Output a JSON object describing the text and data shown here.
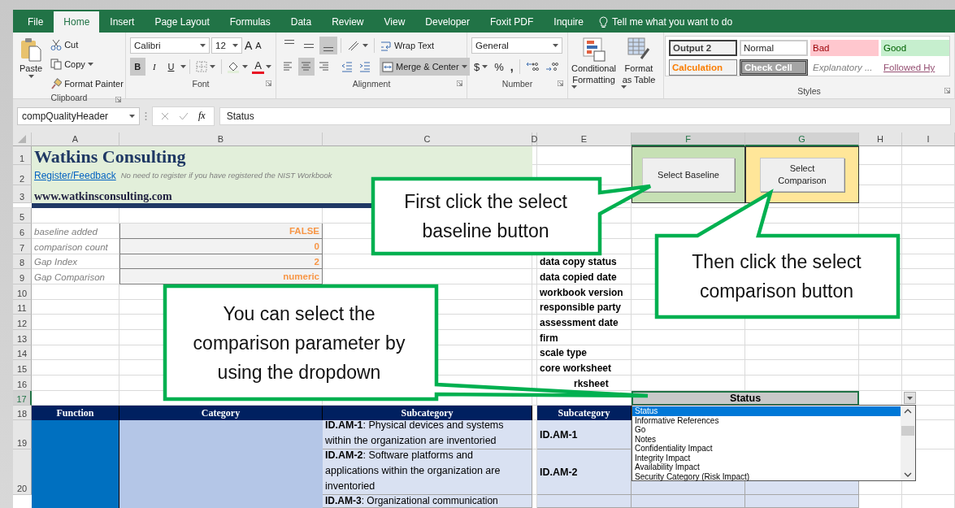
{
  "ribbon_tabs": [
    {
      "label": "File",
      "selected": false
    },
    {
      "label": "Home",
      "selected": true
    },
    {
      "label": "Insert",
      "selected": false
    },
    {
      "label": "Page Layout",
      "selected": false
    },
    {
      "label": "Formulas",
      "selected": false
    },
    {
      "label": "Data",
      "selected": false
    },
    {
      "label": "Review",
      "selected": false
    },
    {
      "label": "View",
      "selected": false
    },
    {
      "label": "Developer",
      "selected": false
    },
    {
      "label": "Foxit PDF",
      "selected": false
    },
    {
      "label": "Inquire",
      "selected": false
    }
  ],
  "tell_me": {
    "placeholder": "Tell me what you want to do"
  },
  "clipboard": {
    "group_label": "Clipboard",
    "paste": "Paste",
    "cut": "Cut",
    "copy": "Copy",
    "format_painter": "Format Painter"
  },
  "font": {
    "group_label": "Font",
    "font_name": "Calibri",
    "font_size": "12",
    "grow": "A",
    "shrink": "A",
    "styles": [
      {
        "kind": "bold",
        "label": "B",
        "selected": true
      },
      {
        "kind": "italic",
        "label": "I",
        "selected": false
      },
      {
        "kind": "underline",
        "label": "U",
        "selected": false
      }
    ],
    "font_color_label": "A"
  },
  "alignment": {
    "group_label": "Alignment",
    "vertical": [
      {
        "kind": "top",
        "selected": false
      },
      {
        "kind": "middle",
        "selected": false
      },
      {
        "kind": "bottom",
        "selected": true
      }
    ],
    "horizontal": [
      {
        "kind": "left",
        "selected": false
      },
      {
        "kind": "center",
        "selected": true
      },
      {
        "kind": "right",
        "selected": false
      }
    ],
    "wrap_text": "Wrap Text",
    "merge_center": {
      "label": "Merge & Center",
      "selected": true
    }
  },
  "number": {
    "group_label": "Number",
    "format": "General",
    "currency": "$",
    "percent": "%",
    "comma": ","
  },
  "conditional_formatting": "Conditional Formatting",
  "format_as_table": "Format as Table",
  "styles": {
    "group_label": "Styles",
    "cells": [
      {
        "kind": "output",
        "label": "Output 2"
      },
      {
        "kind": "normal",
        "label": "Normal"
      },
      {
        "kind": "bad",
        "label": "Bad"
      },
      {
        "kind": "good",
        "label": "Good"
      },
      {
        "kind": "calculation",
        "label": "Calculation"
      },
      {
        "kind": "check",
        "label": "Check Cell"
      },
      {
        "kind": "explanatory",
        "label": "Explanatory ..."
      },
      {
        "kind": "followed_link",
        "label": "Followed Hy"
      }
    ]
  },
  "formula_bar": {
    "name_box": "compQualityHeader",
    "function_label": "fx",
    "value": "Status"
  },
  "columns": [
    {
      "label": "A",
      "selected": false
    },
    {
      "label": "B",
      "selected": false
    },
    {
      "label": "C",
      "selected": false
    },
    {
      "label": "D",
      "selected": false
    },
    {
      "label": "E",
      "selected": false
    },
    {
      "label": "F",
      "selected": true
    },
    {
      "label": "G",
      "selected": true
    },
    {
      "label": "H",
      "selected": false
    },
    {
      "label": "I",
      "selected": false
    }
  ],
  "rows": [
    {
      "label": "1",
      "selected": false
    },
    {
      "label": "2",
      "selected": false
    },
    {
      "label": "3",
      "selected": false
    },
    {
      "label": "5",
      "selected": false
    },
    {
      "label": "6",
      "selected": false
    },
    {
      "label": "7",
      "selected": false
    },
    {
      "label": "8",
      "selected": false
    },
    {
      "label": "9",
      "selected": false
    },
    {
      "label": "10",
      "selected": false
    },
    {
      "label": "11",
      "selected": false
    },
    {
      "label": "12",
      "selected": false
    },
    {
      "label": "13",
      "selected": false
    },
    {
      "label": "14",
      "selected": false
    },
    {
      "label": "15",
      "selected": false
    },
    {
      "label": "16",
      "selected": false
    },
    {
      "label": "17",
      "selected": true
    },
    {
      "label": "18",
      "selected": false
    },
    {
      "label": "19",
      "selected": false
    },
    {
      "label": "20",
      "selected": false
    }
  ],
  "header": {
    "title": "Watkins Consulting",
    "link": "Register/Feedback",
    "note": "No need to register if you have registered the NIST Workbook",
    "website": "www.watkinsconsulting.com"
  },
  "parameters": [
    {
      "label": "baseline added",
      "value": "FALSE"
    },
    {
      "label": "comparison count",
      "value": "0"
    },
    {
      "label": "Gap Index",
      "value": "2"
    },
    {
      "label": "Gap Comparison",
      "value": "numeric"
    }
  ],
  "info_labels": [
    "data copy status",
    "data copied date",
    "workbook version",
    "responsible party",
    "assessment date",
    "firm",
    "scale type",
    "core worksheet",
    "rksheet"
  ],
  "buttons": [
    "Select Baseline",
    "Select Comparison"
  ],
  "comparison_header": "Status",
  "dropdown": [
    {
      "label": "Status",
      "selected": true
    },
    {
      "label": "Informative References",
      "selected": false
    },
    {
      "label": "Go",
      "selected": false
    },
    {
      "label": "Notes",
      "selected": false
    },
    {
      "label": "Confidentiality Impact",
      "selected": false
    },
    {
      "label": "Integrity Impact",
      "selected": false
    },
    {
      "label": "Availability Impact",
      "selected": false
    },
    {
      "label": "Security Category (Risk Impact)",
      "selected": false
    }
  ],
  "table": {
    "columns": [
      "Function",
      "Category",
      "Subcategory"
    ],
    "side_column": "Subcategory",
    "rows": [
      {
        "subcategory": "**ID.AM-1**: Physical devices and systems within the organization are inventoried",
        "id": "ID.AM-1"
      },
      {
        "subcategory": "**ID.AM-2**: Software platforms and applications within the organization are inventoried",
        "id": "ID.AM-2"
      },
      {
        "subcategory": "**ID.AM-3**: Organizational communication"
      }
    ]
  },
  "callouts": [
    "First click the select baseline button",
    "Then click the select comparison button",
    "You can select the comparison parameter by using the dropdown"
  ]
}
